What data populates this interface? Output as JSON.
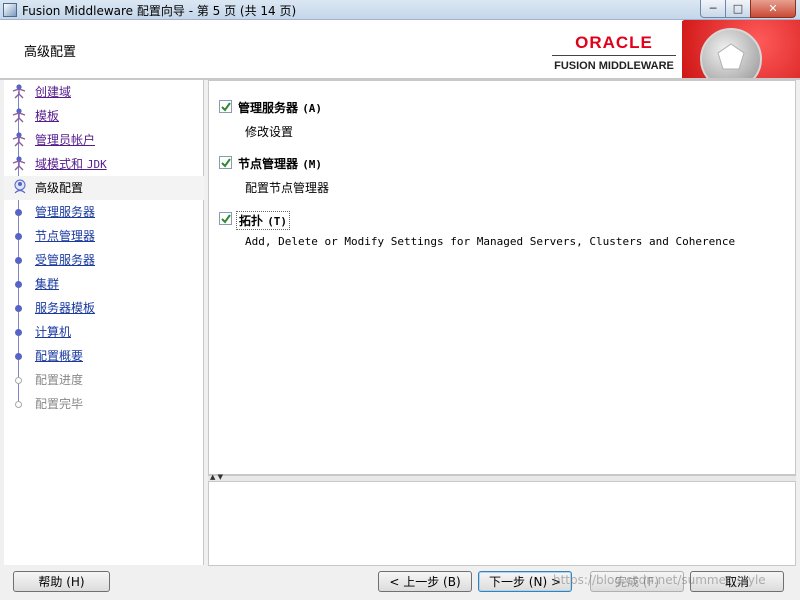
{
  "window": {
    "title": "Fusion Middleware 配置向导 - 第 5 页 (共 14 页)",
    "controls": {
      "minimize": "─",
      "maximize": "□",
      "close": "✕"
    }
  },
  "header": {
    "page_title": "高级配置",
    "brand": "ORACLE",
    "brand_sub": "FUSION MIDDLEWARE"
  },
  "nav": {
    "items": [
      {
        "label": "创建域",
        "state": "visited",
        "mono": ""
      },
      {
        "label": "模板",
        "state": "visited",
        "mono": ""
      },
      {
        "label": "管理员帐户",
        "state": "visited",
        "mono": ""
      },
      {
        "label": "域模式和 ",
        "state": "visited",
        "mono": "JDK"
      },
      {
        "label": "高级配置",
        "state": "current",
        "mono": ""
      },
      {
        "label": "管理服务器",
        "state": "upcoming",
        "mono": ""
      },
      {
        "label": "节点管理器",
        "state": "upcoming",
        "mono": ""
      },
      {
        "label": "受管服务器",
        "state": "upcoming",
        "mono": ""
      },
      {
        "label": "集群",
        "state": "upcoming",
        "mono": ""
      },
      {
        "label": "服务器模板",
        "state": "upcoming",
        "mono": ""
      },
      {
        "label": "计算机",
        "state": "upcoming",
        "mono": ""
      },
      {
        "label": "配置概要",
        "state": "upcoming",
        "mono": ""
      },
      {
        "label": "配置进度",
        "state": "disabled",
        "mono": ""
      },
      {
        "label": "配置完毕",
        "state": "disabled",
        "mono": ""
      }
    ]
  },
  "options": [
    {
      "label": "管理服务器 ",
      "mnemonic": "(A)",
      "description": "修改设置",
      "checked": true,
      "mono_desc": false
    },
    {
      "label": "节点管理器 ",
      "mnemonic": "(M)",
      "description": "配置节点管理器",
      "checked": true,
      "mono_desc": false
    },
    {
      "label": "拓扑 ",
      "mnemonic": "(T)",
      "description": "Add, Delete or Modify Settings for Managed Servers, Clusters and Coherence",
      "checked": true,
      "mono_desc": true
    }
  ],
  "buttons": {
    "help": "帮助 (H)",
    "back": "< 上一步 (B)",
    "next": "下一步 (N) >",
    "finish": "完成 (F)",
    "cancel": "取消"
  },
  "watermark": "https://blog.csdn.net/summer_style",
  "colors": {
    "brand_red": "#e2001a",
    "nav_dot": "#5564c6",
    "visited_link": "#551a8b",
    "link": "#1a3a9e",
    "check": "#2e8b2e"
  }
}
